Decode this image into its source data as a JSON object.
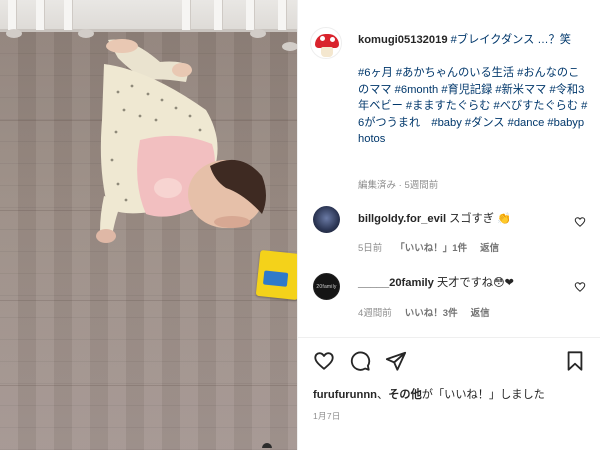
{
  "post": {
    "username": "komugi05132019",
    "caption_lead": "#ブレイクダンス …？笑",
    "hashtags_block": "#6ヶ月 #あかちゃんのいる生活 #おんなのこのママ #6month #育児記録 #新米ママ #令和3年ベビー #まますたぐらむ #べびすたぐらむ #6がつうまれ　#baby #ダンス #dance #babyphotos",
    "caption_meta": "編集済み · 5週間前"
  },
  "comments": [
    {
      "username": "billgoldy.for_evil",
      "text": "スゴすぎ",
      "emoji": "👏",
      "time": "5日前",
      "likes": "「いいね！」1件",
      "reply": "返信"
    },
    {
      "username": "_____20family",
      "text": "天才ですね",
      "emoji": "😳❤",
      "avatar_text": "20family",
      "time": "4週間前",
      "likes": "いいね！3件",
      "reply": "返信"
    }
  ],
  "likes_line": {
    "user": "furufurunnn",
    "separator": "、",
    "others": "その他",
    "suffix": "が「いいね！」しました"
  },
  "date": "1月7日",
  "icons": {
    "like": "heart-outline-icon",
    "comment": "speech-bubble-icon",
    "share": "paper-plane-icon",
    "save": "bookmark-icon"
  },
  "colors": {
    "hashtag": "#00376b",
    "meta": "#8e8e8e",
    "text": "#262626",
    "avatar_cap": "#d9232c"
  }
}
